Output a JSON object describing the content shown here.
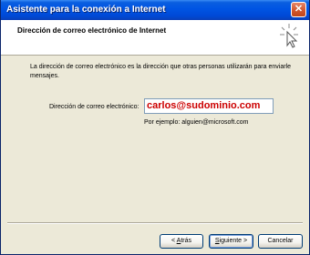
{
  "window": {
    "title": "Asistente para la conexión a Internet",
    "close_glyph": "✕"
  },
  "header": {
    "title": "Dirección de correo electrónico de Internet",
    "icon": "wizard-wand-icon"
  },
  "body": {
    "intro": "La dirección de correo electrónico es la dirección que otras personas utilizarán para enviarle mensajes.",
    "email_label": "Dirección de correo electrónico:",
    "email_value": "carlos@sudominio.com",
    "example": "Por ejemplo: alguien@microsoft.com"
  },
  "buttons": {
    "back_prefix": "< ",
    "back_mnemonic": "A",
    "back_rest": "trás",
    "next_prefix": "",
    "next_mnemonic": "S",
    "next_rest": "iguiente >",
    "cancel": "Cancelar"
  },
  "colors": {
    "title_bar": "#0054e3",
    "dialog_bg": "#ece9d8",
    "email_text": "#cc0000"
  }
}
